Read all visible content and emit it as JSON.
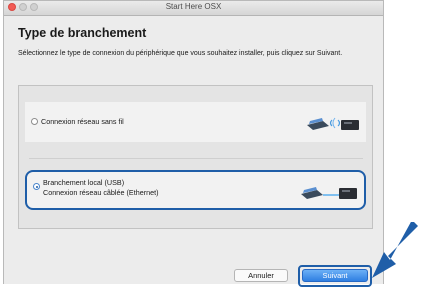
{
  "window": {
    "title": "Start Here OSX"
  },
  "page": {
    "heading": "Type de branchement",
    "instructions": "Sélectionnez le type de connexion du périphérique que vous souhaitez installer, puis cliquez sur Suivant."
  },
  "options": [
    {
      "label": "Connexion réseau sans fil",
      "selected": false,
      "icon": "wireless-network-illustration"
    },
    {
      "label_line1": "Branchement local (USB)",
      "label_line2": "Connexion réseau câblée (Ethernet)",
      "selected": true,
      "icon": "usb-cable-illustration"
    }
  ],
  "buttons": {
    "cancel": "Annuler",
    "next": "Suivant"
  },
  "colors": {
    "accent": "#1f5ea8",
    "primary_button": "#2f7fe2",
    "close_dot": "#f25b55"
  }
}
